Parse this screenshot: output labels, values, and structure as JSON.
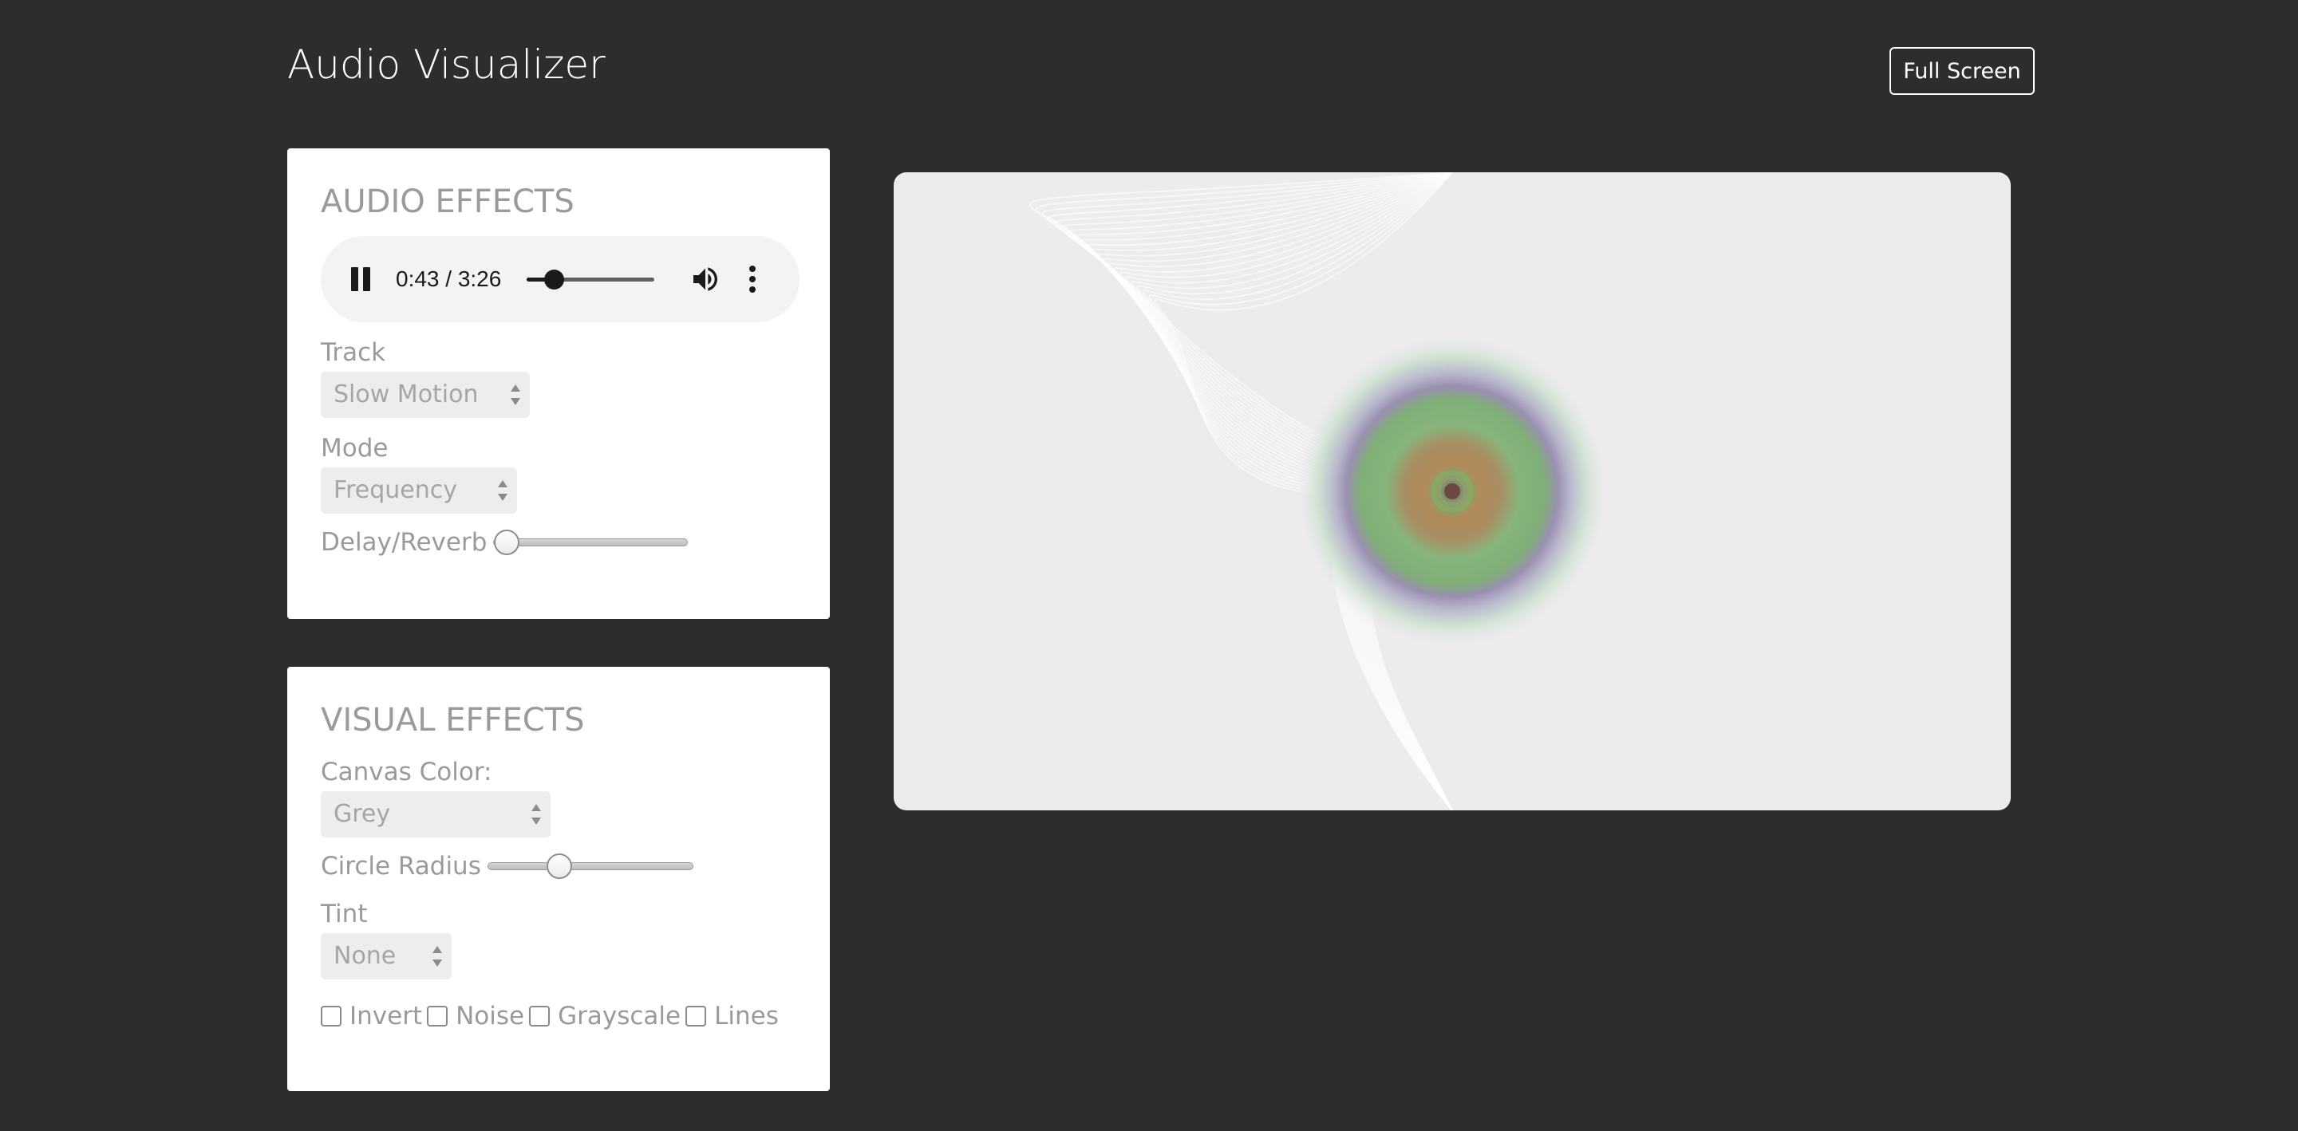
{
  "header": {
    "title": "Audio Visualizer",
    "fullscreen_label": "Full Screen"
  },
  "audio_effects": {
    "heading": "AUDIO EFFECTS",
    "player": {
      "state": "playing",
      "current_time": "0:43",
      "duration": "3:26",
      "time_display": "0:43 / 3:26",
      "progress_fraction": 0.21,
      "icons": {
        "play_pause": "pause-icon",
        "volume": "volume-icon",
        "menu": "more-vert-icon"
      }
    },
    "track": {
      "label": "Track",
      "selected": "Slow Motion"
    },
    "mode": {
      "label": "Mode",
      "selected": "Frequency"
    },
    "delay_reverb": {
      "label": "Delay/Reverb",
      "value_fraction": 0.0
    }
  },
  "visual_effects": {
    "heading": "VISUAL EFFECTS",
    "canvas_color": {
      "label": "Canvas Color:",
      "selected": "Grey"
    },
    "circle_radius": {
      "label": "Circle Radius",
      "value_fraction": 0.35
    },
    "tint": {
      "label": "Tint",
      "selected": "None"
    },
    "checkboxes": [
      {
        "label": "Invert",
        "checked": false
      },
      {
        "label": "Noise",
        "checked": false
      },
      {
        "label": "Grayscale",
        "checked": false
      },
      {
        "label": "Lines",
        "checked": false
      }
    ]
  },
  "colors": {
    "page_background": "#2d2d2d",
    "panel_background": "#ffffff",
    "canvas_background": "#ececec",
    "muted_text": "#9a9a9a"
  }
}
